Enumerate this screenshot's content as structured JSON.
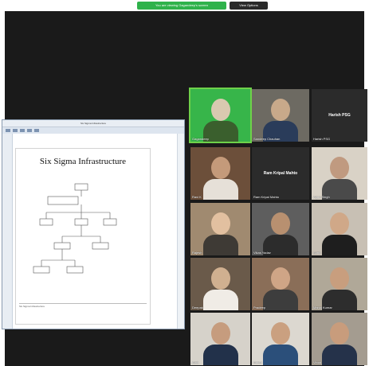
{
  "top_bar": {
    "banner_text": "You are viewing Gagandeep's screen",
    "view_options_label": "View Options"
  },
  "share": {
    "window_title": "Six Sigma Infrastructure",
    "slide_title": "Six Sigma Infrastructure",
    "status_text": "Six Sigma Infrastructure"
  },
  "participants": [
    {
      "name": "Gagandeep",
      "type": "video",
      "active": true
    },
    {
      "name": "Sandeep Chauhan",
      "type": "video"
    },
    {
      "name": "Harish PSG",
      "type": "name"
    },
    {
      "name": "Ravi K",
      "type": "video"
    },
    {
      "name": "Ram Kripal Mahto",
      "type": "name"
    },
    {
      "name": "Arjun Singh",
      "type": "video"
    },
    {
      "name": "Rajesh",
      "type": "video"
    },
    {
      "name": "Vikas Yadav",
      "type": "video"
    },
    {
      "name": "Sunil",
      "type": "video"
    },
    {
      "name": "Deepak",
      "type": "video"
    },
    {
      "name": "Pradeep",
      "type": "video"
    },
    {
      "name": "Manoj Kumar",
      "type": "video"
    },
    {
      "name": "Amit",
      "type": "video"
    },
    {
      "name": "Rahul",
      "type": "video"
    },
    {
      "name": "Vinod",
      "type": "video"
    }
  ],
  "colors": {
    "banner": "#2fb24b",
    "active_speaker": "#6fd14a",
    "background": "#1a1a1a"
  }
}
